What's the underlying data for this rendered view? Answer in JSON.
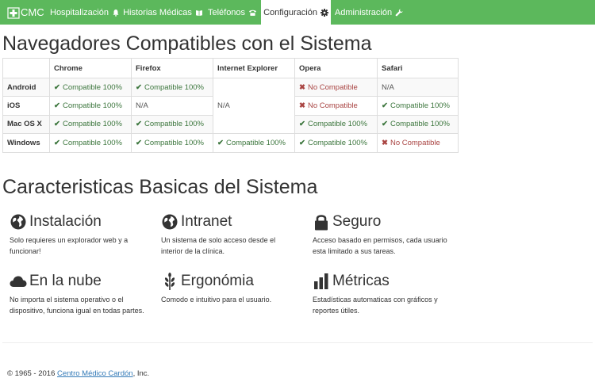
{
  "navbar": {
    "brand": "CMC",
    "items": [
      {
        "label": "Hospitalización",
        "icon": "bell-icon",
        "active": false
      },
      {
        "label": "Historias Médicas",
        "icon": "book-icon",
        "active": false
      },
      {
        "label": "Teléfonos",
        "icon": "phone-icon",
        "active": false
      },
      {
        "label": "Configuración",
        "icon": "gear-icon",
        "active": true
      },
      {
        "label": "Administración",
        "icon": "wrench-icon",
        "active": false
      }
    ]
  },
  "compat": {
    "title": "Navegadores Compatibles con el Sistema",
    "columns": [
      "",
      "Chrome",
      "Firefox",
      "Internet Explorer",
      "Opera",
      "Safari"
    ],
    "rows": [
      {
        "os": "Android",
        "cells": [
          "Compatible 100%",
          "Compatible 100%",
          "N/A",
          "No Compatible",
          "N/A"
        ]
      },
      {
        "os": "iOS",
        "cells": [
          "Compatible 100%",
          "N/A",
          "",
          "No Compatible",
          "Compatible 100%"
        ]
      },
      {
        "os": "Mac OS X",
        "cells": [
          "Compatible 100%",
          "Compatible 100%",
          "",
          "Compatible 100%",
          "Compatible 100%"
        ]
      },
      {
        "os": "Windows",
        "cells": [
          "Compatible 100%",
          "Compatible 100%",
          "Compatible 100%",
          "Compatible 100%",
          "No Compatible"
        ]
      }
    ]
  },
  "features": {
    "title": "Caracteristicas Basicas del Sistema",
    "items": [
      {
        "title": "Instalación",
        "icon": "globe-icon",
        "desc": "Solo requieres un explorador web y a funcionar!"
      },
      {
        "title": "Intranet",
        "icon": "globe-icon",
        "desc": "Un sistema de solo acceso desde el interior de la clínica."
      },
      {
        "title": "Seguro",
        "icon": "lock-icon",
        "desc": "Acceso basado en permisos, cada usuario esta limitado a sus tareas."
      },
      {
        "title": "En la nube",
        "icon": "cloud-icon",
        "desc": "No importa el sistema operativo o el dispositivo, funciona igual en todas partes."
      },
      {
        "title": "Ergonómia",
        "icon": "grain-icon",
        "desc": "Comodo e intuitivo para el usuario."
      },
      {
        "title": "Métricas",
        "icon": "bar-chart-icon",
        "desc": "Estadísticas automaticas con gráficos y reportes útiles."
      }
    ]
  },
  "footer": {
    "prefix": "© 1965 - 2016",
    "link": "Centro Médico Cardón",
    "suffix": ", Inc."
  },
  "colors": {
    "navbar": "#5cb85c",
    "compatible": "#3c763d",
    "not_compatible": "#a94442",
    "link": "#337ab7"
  }
}
